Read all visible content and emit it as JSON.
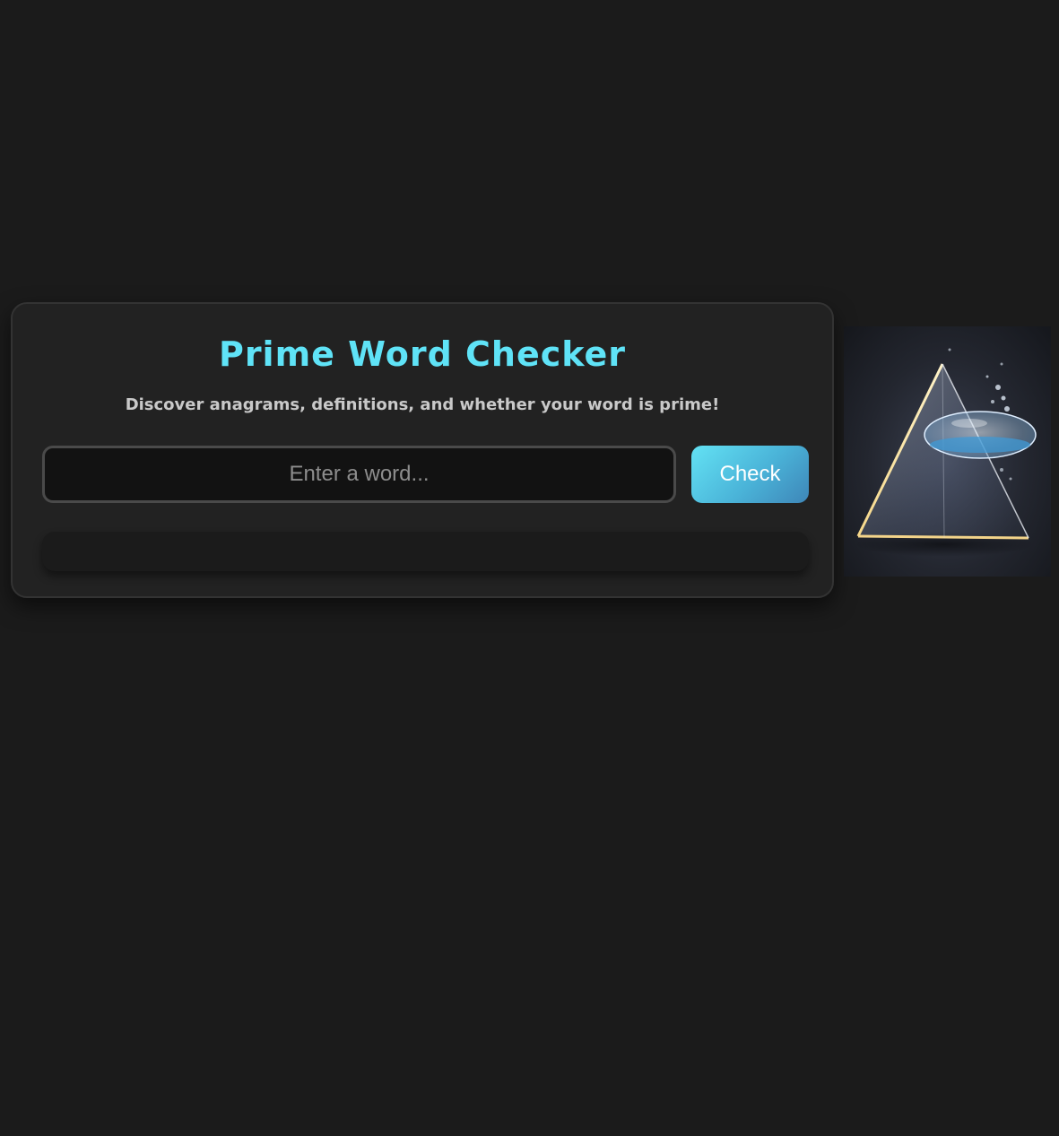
{
  "app": {
    "title": "Prime Word Checker",
    "subtitle": "Discover anagrams, definitions, and whether your word is prime!"
  },
  "search": {
    "placeholder": "Enter a word...",
    "value": ""
  },
  "actions": {
    "check_label": "Check"
  },
  "result": {
    "text": ""
  },
  "image": {
    "alt": "Glass prism pyramid with floating water bubble"
  },
  "colors": {
    "background": "#1b1b1b",
    "card": "#222222",
    "accent": "#5fe3f7",
    "button_start": "#63e2f4",
    "button_end": "#3e86b8"
  }
}
